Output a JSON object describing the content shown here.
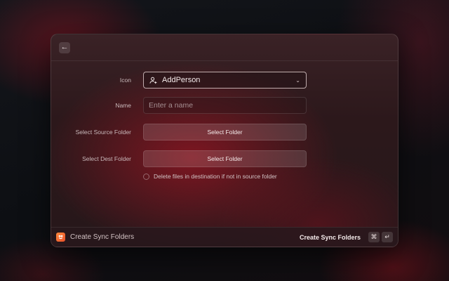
{
  "topbar": {
    "back_icon": "arrow-left-icon",
    "back_glyph": "←"
  },
  "form": {
    "icon": {
      "label": "Icon",
      "value": "AddPerson",
      "value_icon": "add-person-icon",
      "chevron": "⌄"
    },
    "name": {
      "label": "Name",
      "placeholder": "Enter a name",
      "value": ""
    },
    "source": {
      "label": "Select Source Folder",
      "button": "Select Folder"
    },
    "dest": {
      "label": "Select Dest Folder",
      "button": "Select Folder"
    },
    "delete_option": {
      "label": "Delete files in destination if not in source folder",
      "checked": false
    }
  },
  "footer": {
    "app_icon": "raycast-extension-icon",
    "title": "Create Sync Folders",
    "action": "Create Sync Folders",
    "shortcut": [
      "⌘",
      "↵"
    ]
  },
  "colors": {
    "accent": "#e8502a",
    "window_bg": "#2c181b"
  }
}
